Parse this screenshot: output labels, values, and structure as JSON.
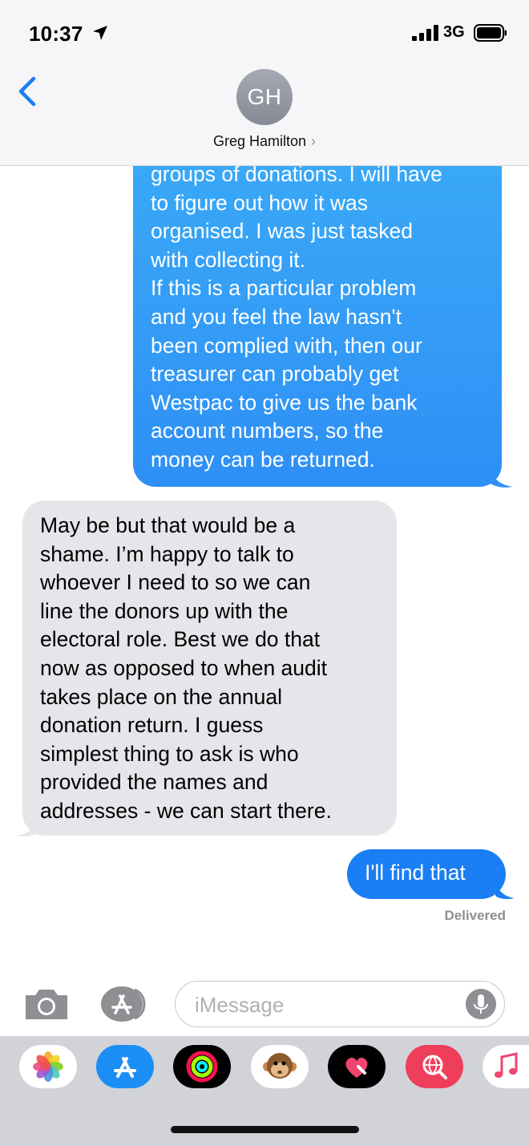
{
  "status_bar": {
    "time": "10:37",
    "network": "3G",
    "icons": [
      "location-arrow-icon",
      "signal-bars-icon",
      "battery-icon"
    ]
  },
  "header": {
    "avatar_initials": "GH",
    "contact_name": "Greg Hamilton",
    "chevron": "›",
    "back_icon": "chevron-left-icon"
  },
  "messages": [
    {
      "direction": "sent",
      "lines": [
        "groups of donations. I will have",
        "to figure out how it was",
        "organised. I was just tasked",
        "with collecting it.",
        "If this is a particular problem",
        "and you feel the law hasn't",
        "been complied with, then our",
        "treasurer can probably get",
        "Westpac to give us the bank",
        "account numbers, so the",
        "money can be returned."
      ]
    },
    {
      "direction": "received",
      "lines": [
        "May be but that would be a",
        "shame. I’m happy to talk to",
        "whoever I need to so we can",
        "line the donors up with the",
        "electoral role. Best we do that",
        "now as opposed to when audit",
        "takes place on the annual",
        "donation return. I guess",
        "simplest thing to ask is who",
        "provided the names and",
        "addresses - we can start there."
      ]
    },
    {
      "direction": "sent",
      "lines": [
        "I'll find that"
      ]
    }
  ],
  "delivery_status": "Delivered",
  "composer": {
    "placeholder": "iMessage",
    "icons": [
      "camera-icon",
      "app-store-icon",
      "microphone-icon"
    ]
  },
  "app_drawer": {
    "apps": [
      "photos-app-icon",
      "app-store-app-icon",
      "activity-app-icon",
      "animoji-app-icon",
      "digital-touch-app-icon",
      "web-images-app-icon",
      "music-app-icon"
    ]
  },
  "colors": {
    "sent_bubble": "#2e8ff5",
    "received_bubble": "#e5e5ea",
    "header_bg": "#f6f6f8",
    "drawer_bg": "#d1d3d9"
  }
}
